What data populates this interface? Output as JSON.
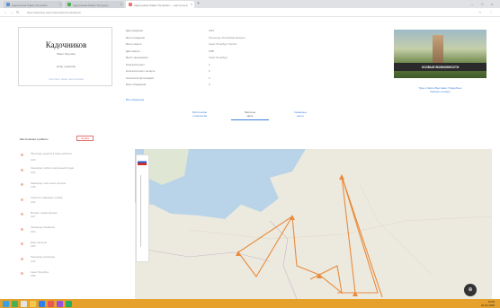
{
  "browser": {
    "tabs": [
      {
        "title": "Кадочников Павел Петрович"
      },
      {
        "title": "Кадочников Павел Петрович — места на карте"
      }
    ],
    "url": "https://www.kino-teatr.ru/kino/acter/sov/2/places/"
  },
  "profile": {
    "edit": "…",
    "name": "Кадочников",
    "first_names": "Павел Петрович",
    "role": "актёр, режиссёр",
    "stats": "Смотрите также: места жизни"
  },
  "info": {
    "rows": [
      {
        "key": "Дата рождения",
        "value": "1915"
      },
      {
        "key": "Место рождения",
        "value": "Петроград, Российская империя"
      },
      {
        "key": "Место смерти",
        "value": "Санкт-Петербург, Россия"
      },
      {
        "key": "Дата смерти",
        "value": "1988"
      },
      {
        "key": "Место захоронения",
        "value": "Санкт-Петербург"
      },
      {
        "key": "Количество мест",
        "value": "9"
      },
      {
        "key": "Количество мест на карте",
        "value": "9"
      },
      {
        "key": "Количество фотографий",
        "value": "0"
      },
      {
        "key": "Всего обращений",
        "value": "8"
      }
    ],
    "more_link": "Все обращения"
  },
  "ad": {
    "banner": "ОСОБЫЕ ВОЗМОЖНОСТИ",
    "title": "Туры в Экспо Выставки. Подробнее",
    "subtitle": "Смотреть на карте"
  },
  "center_tabs": [
    {
      "label": "Места жизни",
      "label2": "и творчества"
    },
    {
      "label": "Места на",
      "label2": "карте"
    },
    {
      "label": "Связанные",
      "label2": "места"
    }
  ],
  "places": {
    "header": "Места жизни и работы",
    "sort": "по дате",
    "items": [
      {
        "title": "Петроград: родился в семье рабочего",
        "date": "1915"
      },
      {
        "title": "Ленинград: учёба в театральной студии",
        "date": "1929"
      },
      {
        "title": "Ленинград: театр юного зрителя",
        "date": "1935"
      },
      {
        "title": "Алма-Ата: эвакуация, съёмки",
        "date": "1942"
      },
      {
        "title": "Москва: съёмки фильма",
        "date": "1947"
      },
      {
        "title": "Ленинград: Ленфильм",
        "date": "1950"
      },
      {
        "title": "Киев: гастроли",
        "date": "1955"
      },
      {
        "title": "Ленинград: режиссура",
        "date": "1960"
      },
      {
        "title": "Санкт-Петербург",
        "date": "1988"
      }
    ]
  },
  "map": {
    "fab": "⊕"
  },
  "taskbar": {
    "time": "12:00",
    "date": "01.01.2020"
  }
}
